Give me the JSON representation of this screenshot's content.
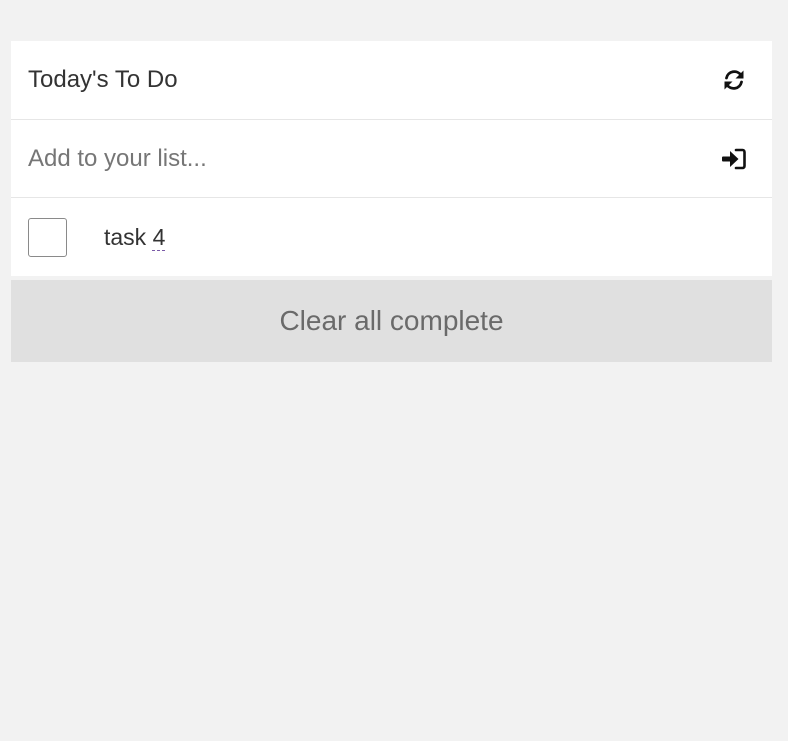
{
  "header": {
    "title": "Today's To Do",
    "refresh_icon": "refresh-icon"
  },
  "add_task": {
    "placeholder": "Add to your list...",
    "value": "",
    "submit_icon": "sign-in-icon"
  },
  "tasks": [
    {
      "label_prefix": "task ",
      "label_suffix": "4",
      "completed": false
    }
  ],
  "footer": {
    "clear_label": "Clear all complete"
  },
  "colors": {
    "background": "#f2f2f2",
    "card": "#ffffff",
    "button": "#e0e0e0",
    "text": "#333333"
  }
}
